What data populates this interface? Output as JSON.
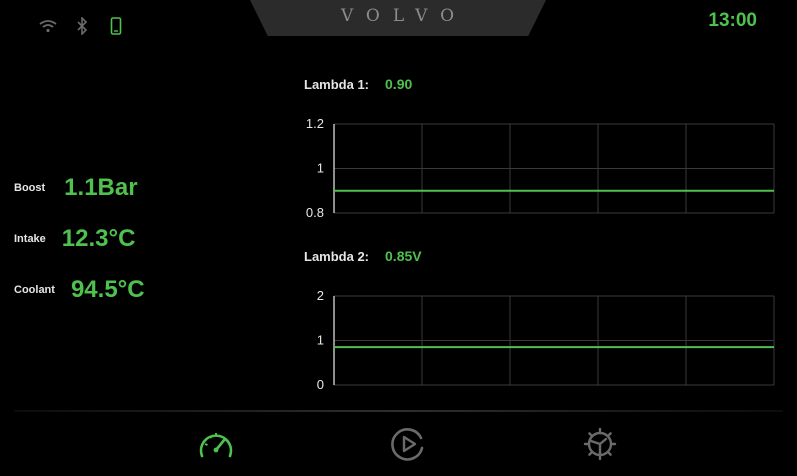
{
  "header": {
    "brand": "VOLVO",
    "time": "13:00"
  },
  "status_icons": [
    "wifi-icon",
    "bluetooth-icon",
    "phone-icon"
  ],
  "readouts": [
    {
      "label": "Boost",
      "value": "1.1Bar"
    },
    {
      "label": "Intake",
      "value": "12.3°C"
    },
    {
      "label": "Coolant",
      "value": "94.5°C"
    }
  ],
  "lambda1": {
    "label": "Lambda 1:",
    "value": "0.90"
  },
  "lambda2": {
    "label": "Lambda 2:",
    "value": "0.85V"
  },
  "chart_data": [
    {
      "type": "line",
      "ylim": [
        0.8,
        1.2
      ],
      "yticks": [
        "1.2",
        "1",
        "0.8"
      ],
      "grid": true,
      "series": [
        {
          "values": [
            0.9,
            0.9,
            0.9,
            0.9,
            0.9,
            0.9
          ]
        }
      ],
      "color": "#4fc14f"
    },
    {
      "type": "line",
      "ylim": [
        0,
        2
      ],
      "yticks": [
        "2",
        "1",
        "0"
      ],
      "grid": true,
      "series": [
        {
          "values": [
            0.85,
            0.85,
            0.85,
            0.85,
            0.85,
            0.85
          ]
        }
      ],
      "color": "#4fc14f"
    }
  ],
  "nav": [
    "gauge-icon",
    "play-icon",
    "settings-icon"
  ],
  "colors": {
    "accent": "#4fc14f",
    "inactive_icon": "#6a6a6a",
    "grid": "#3a3a3a"
  }
}
